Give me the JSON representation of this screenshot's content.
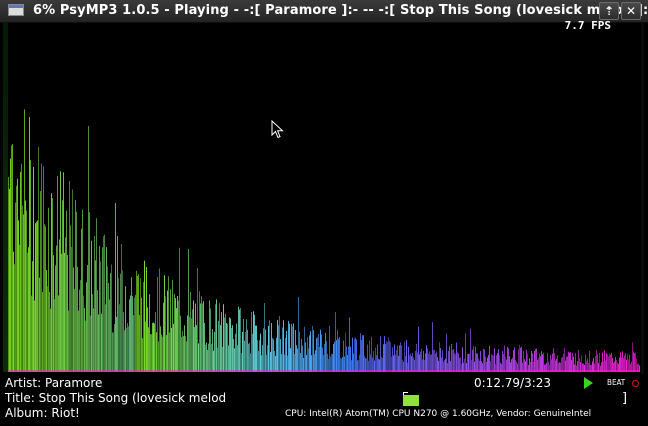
{
  "window": {
    "title": "6% PsyMP3 1.0.5 - Playing - -:[ Paramore ]:- -- -:[ Stop This Song (lovesick melod ]:-",
    "maximize_glyph": "⇡",
    "close_glyph": "✕",
    "icon": "window-app-icon"
  },
  "overlay": {
    "fps": "7.7 FPS"
  },
  "track": {
    "artist_line": "Artist: Paramore",
    "title_line": "Title: Stop This Song (lovesick melod",
    "album_line": "Album: Riot!",
    "time": "0:12.79/3:23"
  },
  "status": {
    "beat_label": "BEAT",
    "play_icon": "play-icon",
    "beat_indicator_icon": "beat-dot-icon",
    "volume_close_bracket": "]",
    "cpu": "CPU: Intel(R) Atom(TM) CPU N270   @ 1.60GHz, Vendor: GenuineIntel"
  },
  "colors": {
    "background": "#000000",
    "text": "#ffffff",
    "spectrum_start": "#7be21c",
    "spectrum_mid": "#3a7bff",
    "spectrum_end": "#ff1ad6",
    "play": "#3ad51f",
    "beat_dot": "#d01818"
  }
}
